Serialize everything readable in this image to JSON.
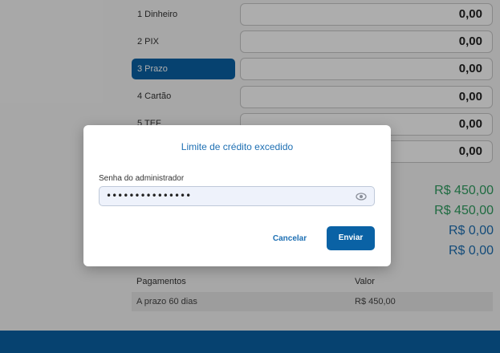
{
  "methods": [
    {
      "label": "1 Dinheiro",
      "amount": "0,00"
    },
    {
      "label": "2 PIX",
      "amount": "0,00"
    },
    {
      "label": "3 Prazo",
      "amount": "0,00",
      "active": true
    },
    {
      "label": "4 Cartão",
      "amount": "0,00"
    },
    {
      "label": "5 TEF",
      "amount": "0,00"
    },
    {
      "label": "",
      "amount": "0,00"
    }
  ],
  "summary": {
    "value1": "R$ 450,00",
    "value2": "R$ 450,00",
    "value3": "R$ 0,00",
    "value4": "R$ 0,00"
  },
  "payments": {
    "col_payments": "Pagamentos",
    "col_value": "Valor",
    "rows": [
      {
        "description": "A prazo 60 dias",
        "value": "R$ 450,00"
      }
    ]
  },
  "dialog": {
    "title": "Limite de crédito excedido",
    "field_label": "Senha do administrador",
    "password_masked": "•••••••••••••••",
    "cancel_label": "Cancelar",
    "send_label": "Enviar"
  },
  "colors": {
    "primary": "#0a62a5",
    "positive": "#2e9e61",
    "link": "#1d6fb3"
  },
  "icons": {
    "password_toggle": "eye-icon"
  }
}
